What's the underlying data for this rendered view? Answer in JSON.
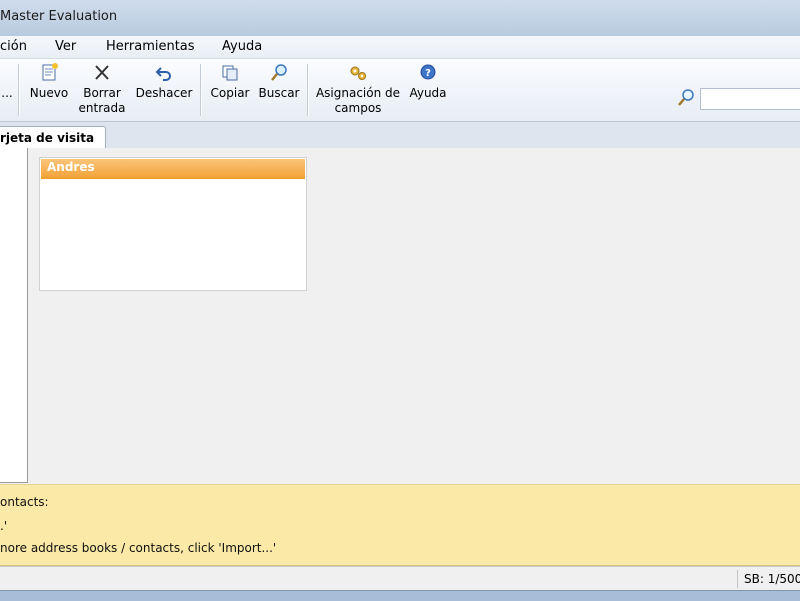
{
  "window": {
    "title": "Master Evaluation"
  },
  "menu": [
    "ción",
    "Ver",
    "Herramientas",
    "Ayuda"
  ],
  "toolbar": {
    "ellipsis": "...",
    "nuevo": "Nuevo",
    "borrar_1": "Borrar",
    "borrar_2": "entrada",
    "deshacer": "Deshacer",
    "copiar": "Copiar",
    "buscar": "Buscar",
    "asignacion_1": "Asignación de",
    "asignacion_2": "campos",
    "ayuda": "Ayuda",
    "search_value": ""
  },
  "tabs": [
    "rjeta de visita"
  ],
  "card": {
    "name": "Andres"
  },
  "info": {
    "line1": "ontacts:",
    "line2": ".'",
    "line3": "nore address books / contacts, click 'Import...'"
  },
  "status": {
    "sb": "SB: 1/500"
  },
  "colors": {
    "card_header": "#f3a53c",
    "info_bg": "#fbe9a7"
  }
}
